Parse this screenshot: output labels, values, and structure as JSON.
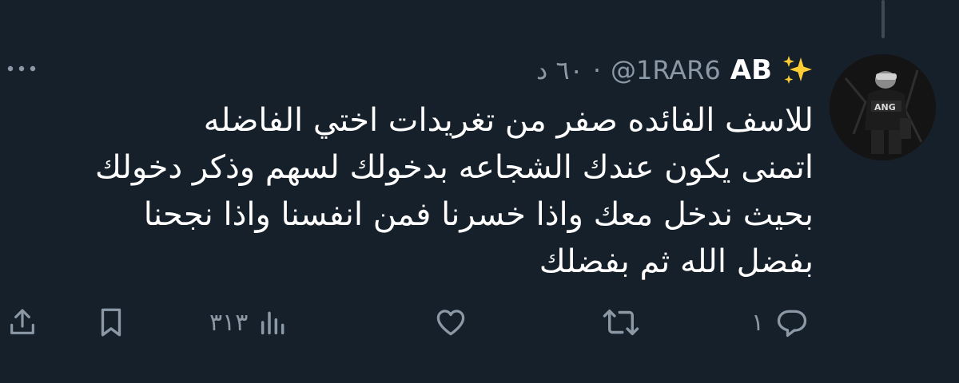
{
  "tweet": {
    "author": {
      "display_name": "AB",
      "handle": "@1RAR6",
      "avatar_icon": "avatar-photo"
    },
    "separator": "·",
    "time": "٦٠ د",
    "text_lines": [
      "للاسف الفائده صفر من تغريدات اختي الفاضله",
      "اتمنى يكون عندك الشجاعه بدخولك لسهم وذكر دخولك",
      "بحيث ندخل معك واذا خسرنا فمن انفسنا واذا نجحنا",
      "بفضل الله ثم بفضلك"
    ],
    "actions": {
      "reply_count": "١",
      "retweet_count": "",
      "like_count": "",
      "views_count": "٣١٣"
    }
  },
  "icons": {
    "sparkle": "sparkles-emoji",
    "more": "more-horizontal-icon",
    "reply": "reply-icon",
    "retweet": "retweet-icon",
    "like": "heart-icon",
    "views": "analytics-icon",
    "bookmark": "bookmark-icon",
    "share": "share-icon"
  },
  "colors": {
    "background": "#16202b",
    "text_primary": "#ffffff",
    "text_secondary": "#8b98a5",
    "thread_line": "#3e4953",
    "sparkle": "#ffcc33"
  }
}
